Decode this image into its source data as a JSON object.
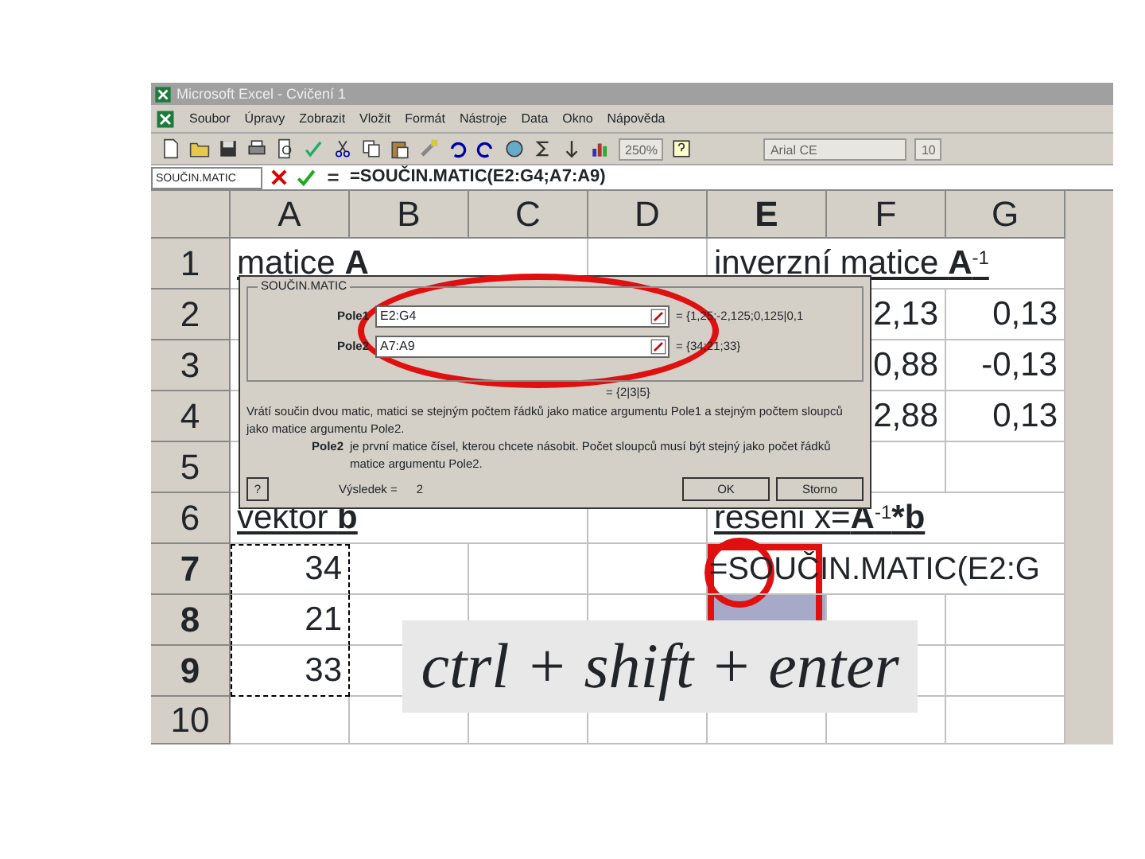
{
  "window": {
    "title": "Microsoft Excel - Cvičení 1"
  },
  "menu": [
    "Soubor",
    "Úpravy",
    "Zobrazit",
    "Vložit",
    "Formát",
    "Nástroje",
    "Data",
    "Okno",
    "Nápověda"
  ],
  "toolbar": {
    "zoom": "250%",
    "font": "Arial CE",
    "size": "10"
  },
  "formula_bar": {
    "name_box": "SOUČIN.MATIC",
    "formula": "=SOUČIN.MATIC(E2:G4;A7:A9)"
  },
  "sheet": {
    "columns": [
      {
        "label": "A",
        "selected": false
      },
      {
        "label": "B",
        "selected": false
      },
      {
        "label": "C",
        "selected": false
      },
      {
        "label": "D",
        "selected": false
      },
      {
        "label": "E",
        "selected": true
      },
      {
        "label": "F",
        "selected": false
      },
      {
        "label": "G",
        "selected": false
      }
    ],
    "rows": [
      {
        "header": "1",
        "selected": false,
        "cells": [
          {
            "text": "matice **A**",
            "kind": "title",
            "selected": false,
            "copied": false
          },
          null,
          null,
          null,
          {
            "text": "inverzní matice **A**$^{-1}$",
            "kind": "title",
            "selected": false,
            "copied": false
          },
          null,
          null
        ]
      },
      {
        "header": "2",
        "selected": false,
        "cells": [
          null,
          null,
          null,
          null,
          null,
          {
            "text": "2,13",
            "kind": "number",
            "selected": false,
            "copied": false
          },
          {
            "text": "0,13",
            "kind": "number",
            "selected": false,
            "copied": false
          }
        ]
      },
      {
        "header": "3",
        "selected": false,
        "cells": [
          null,
          null,
          null,
          null,
          null,
          {
            "text": "0,88",
            "kind": "number",
            "selected": false,
            "copied": false
          },
          {
            "text": "-0,13",
            "kind": "number",
            "selected": false,
            "copied": false
          }
        ]
      },
      {
        "header": "4",
        "selected": false,
        "cells": [
          null,
          null,
          null,
          null,
          null,
          {
            "text": "2,88",
            "kind": "number",
            "selected": false,
            "copied": false
          },
          {
            "text": "0,13",
            "kind": "number",
            "selected": false,
            "copied": false
          }
        ]
      },
      {
        "header": "5",
        "selected": false,
        "cells": [
          null,
          null,
          null,
          null,
          null,
          null,
          null
        ]
      },
      {
        "header": "6",
        "selected": false,
        "cells": [
          {
            "text": "vektor **b**",
            "kind": "title",
            "selected": false,
            "copied": false
          },
          null,
          null,
          null,
          {
            "text": "reseni x=**A**$^{-1}$***b**",
            "kind": "title",
            "selected": false,
            "copied": false
          },
          null,
          null
        ]
      },
      {
        "header": "7",
        "selected": true,
        "cells": [
          {
            "text": "34",
            "kind": "number",
            "selected": false,
            "copied": true
          },
          null,
          null,
          null,
          {
            "text": "=SOUČIN.MATIC(E2:G",
            "kind": "formula",
            "selected": false,
            "copied": false
          },
          null,
          null
        ]
      },
      {
        "header": "8",
        "selected": true,
        "cells": [
          {
            "text": "21",
            "kind": "number",
            "selected": false,
            "copied": true
          },
          null,
          null,
          null,
          {
            "selected": true,
            "copied": false
          },
          null,
          null
        ]
      },
      {
        "header": "9",
        "selected": true,
        "cells": [
          {
            "text": "33",
            "kind": "number",
            "selected": false,
            "copied": true
          },
          null,
          null,
          null,
          null,
          null,
          null
        ]
      },
      {
        "header": "10",
        "selected": false,
        "cells": [
          null,
          null,
          null,
          null,
          null,
          null,
          null
        ]
      }
    ]
  },
  "dialog": {
    "group": "SOUČIN.MATIC",
    "args": [
      {
        "label": "Pole1",
        "value": "E2:G4",
        "result": "= {1,25;-2,125;0,125|0,1"
      },
      {
        "label": "Pole2",
        "value": "A7:A9",
        "result": "= {34;21;33}"
      }
    ],
    "result_preview": "= {2|3|5}",
    "description": "Vrátí součin dvou matic, matici se stejným počtem řádků jako matice argumentu Pole1 a stejným počtem sloupců jako matice argumentu Pole2.",
    "arg_help_label": "Pole2",
    "arg_help": "je první matice čísel, kterou chcete násobit. Počet sloupců musí být stejný jako počet řádků matice argumentu Pole2.",
    "help_button": "?",
    "result_label": "Výsledek =",
    "result_value": "2",
    "buttons": [
      "OK",
      "Storno"
    ]
  },
  "callout": {
    "text": "ctrl + shift + enter"
  }
}
